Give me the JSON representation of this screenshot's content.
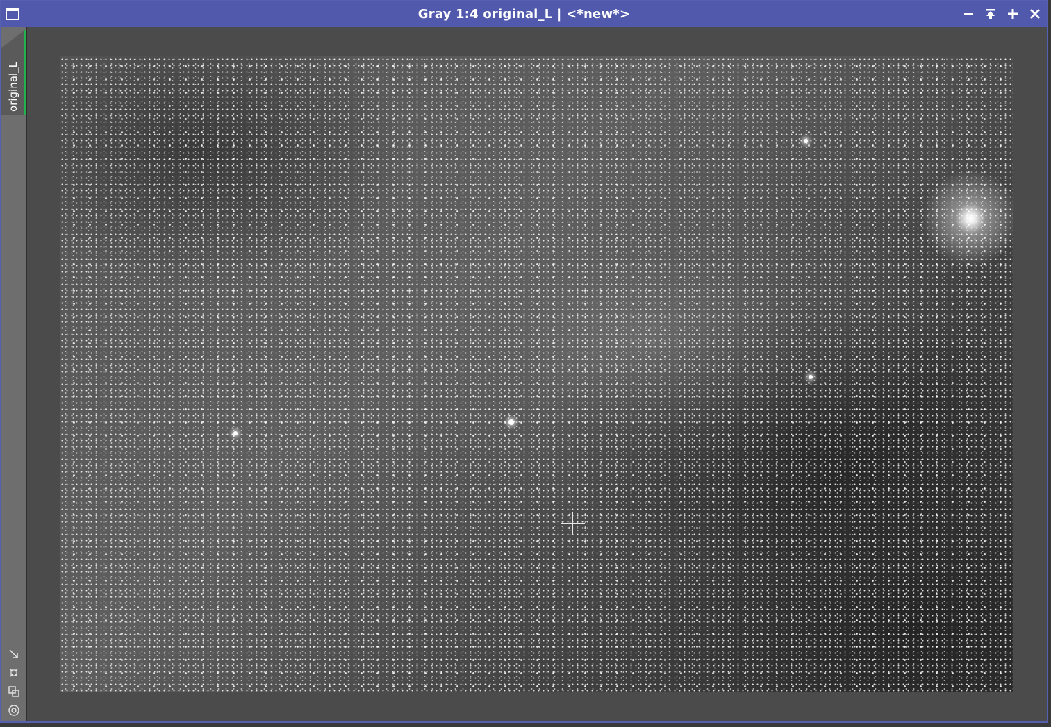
{
  "window": {
    "title": "Gray 1:4 original_L | <*new*>",
    "buttons": [
      "minimize-icon",
      "shade-icon",
      "maximize-icon",
      "close-icon"
    ]
  },
  "sidebar": {
    "tab_label": "original_L",
    "tools": [
      "fit-view-icon",
      "zoom-to-fit-icon",
      "clone-icon",
      "target-icon"
    ]
  },
  "colors": {
    "titlebar": "#5159ad",
    "tab_indicator": "#23b14d",
    "workspace": "#4b4b4b"
  }
}
